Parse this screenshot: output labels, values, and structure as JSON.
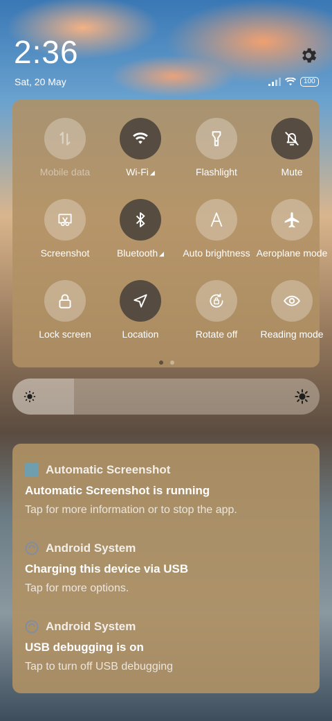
{
  "status_bar": {
    "time": "2:36",
    "date": "Sat, 20 May",
    "battery": "100"
  },
  "quick_settings": {
    "tiles": [
      {
        "label": "Mobile data",
        "icon": "mobile-data-icon",
        "state": "disabled"
      },
      {
        "label": "Wi-Fi",
        "icon": "wifi-icon",
        "state": "on"
      },
      {
        "label": "Flashlight",
        "icon": "flashlight-icon",
        "state": "off"
      },
      {
        "label": "Mute",
        "icon": "mute-bell-icon",
        "state": "on"
      },
      {
        "label": "Screenshot",
        "icon": "screenshot-scissors-icon",
        "state": "off"
      },
      {
        "label": "Bluetooth",
        "icon": "bluetooth-icon",
        "state": "on"
      },
      {
        "label": "Auto brightness",
        "icon": "auto-brightness-icon",
        "state": "off"
      },
      {
        "label": "Aeroplane mode",
        "icon": "airplane-icon",
        "state": "off"
      },
      {
        "label": "Lock screen",
        "icon": "lock-icon",
        "state": "off"
      },
      {
        "label": "Location",
        "icon": "location-arrow-icon",
        "state": "on"
      },
      {
        "label": "Rotate off",
        "icon": "rotate-lock-icon",
        "state": "off"
      },
      {
        "label": "Reading mode",
        "icon": "eye-icon",
        "state": "off"
      }
    ],
    "page_count": 2,
    "active_page": 1
  },
  "brightness": {
    "level": 0.2
  },
  "notifications": [
    {
      "app": "Automatic Screenshot",
      "title": "Automatic Screenshot is running",
      "text": "Tap for more information or to stop the app."
    },
    {
      "app": "Android System",
      "title": "Charging this device via USB",
      "text": "Tap for more options."
    },
    {
      "app": "Android System",
      "title": "USB debugging is on",
      "text": "Tap to turn off USB debugging"
    }
  ],
  "colors": {
    "panel": "#b09164",
    "tile_on": "#46403a",
    "tile_off": "#ffffff47"
  }
}
